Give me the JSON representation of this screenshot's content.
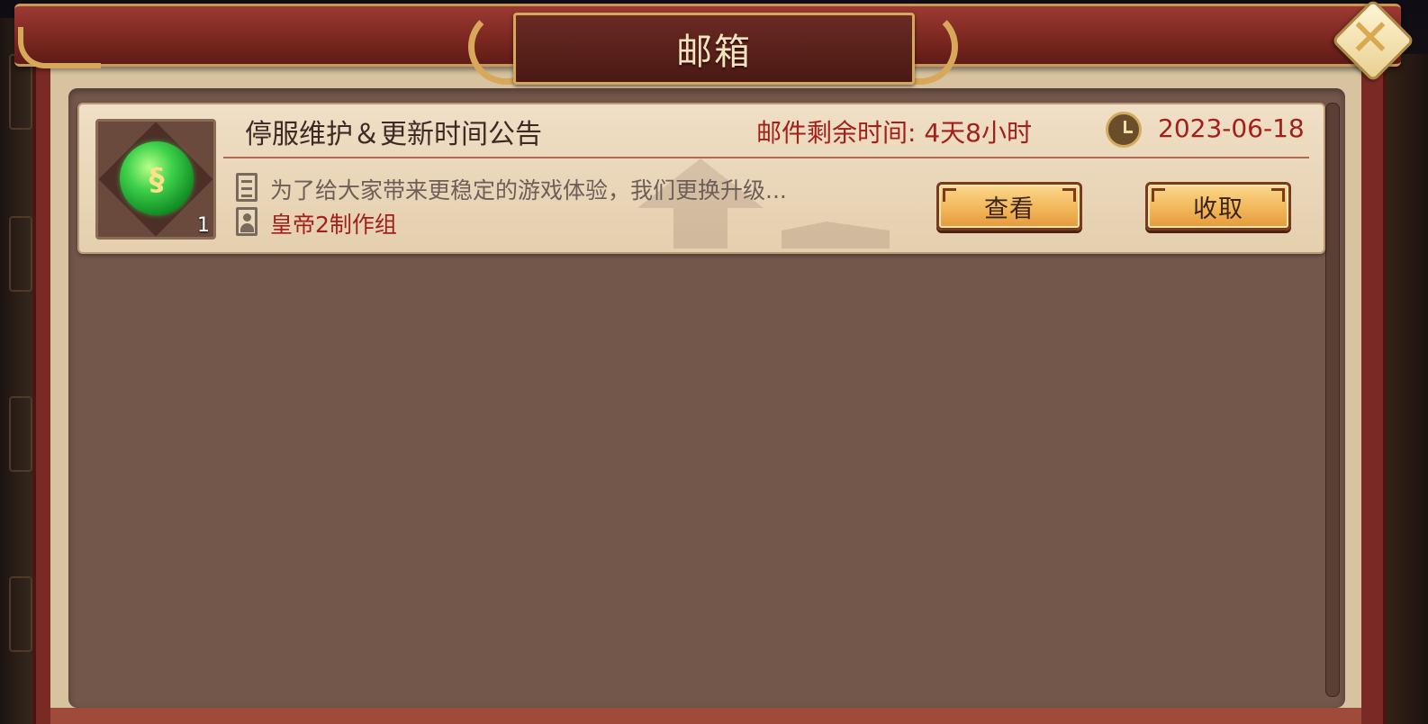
{
  "window": {
    "title": "邮箱"
  },
  "close_button": {
    "glyph": "✕"
  },
  "mails": [
    {
      "title": "停服维护＆更新时间公告",
      "remaining_time": "邮件剩余时间: 4天8小时",
      "date": "2023-06-18",
      "preview": "为了给大家带来更稳定的游戏体验，我们更换升级...",
      "sender": "皇帝2制作组",
      "attachment": {
        "icon": "green-jade-orb",
        "count": "1"
      },
      "buttons": {
        "view_label": "查看",
        "collect_label": "收取"
      }
    }
  ],
  "colors": {
    "frame": "#7a2a25",
    "gold": "#d8a85a",
    "content_bg": "#74574b",
    "mail_bg": "#f0dfc6",
    "accent_red": "#a3201a",
    "button": "#f2b75a"
  }
}
